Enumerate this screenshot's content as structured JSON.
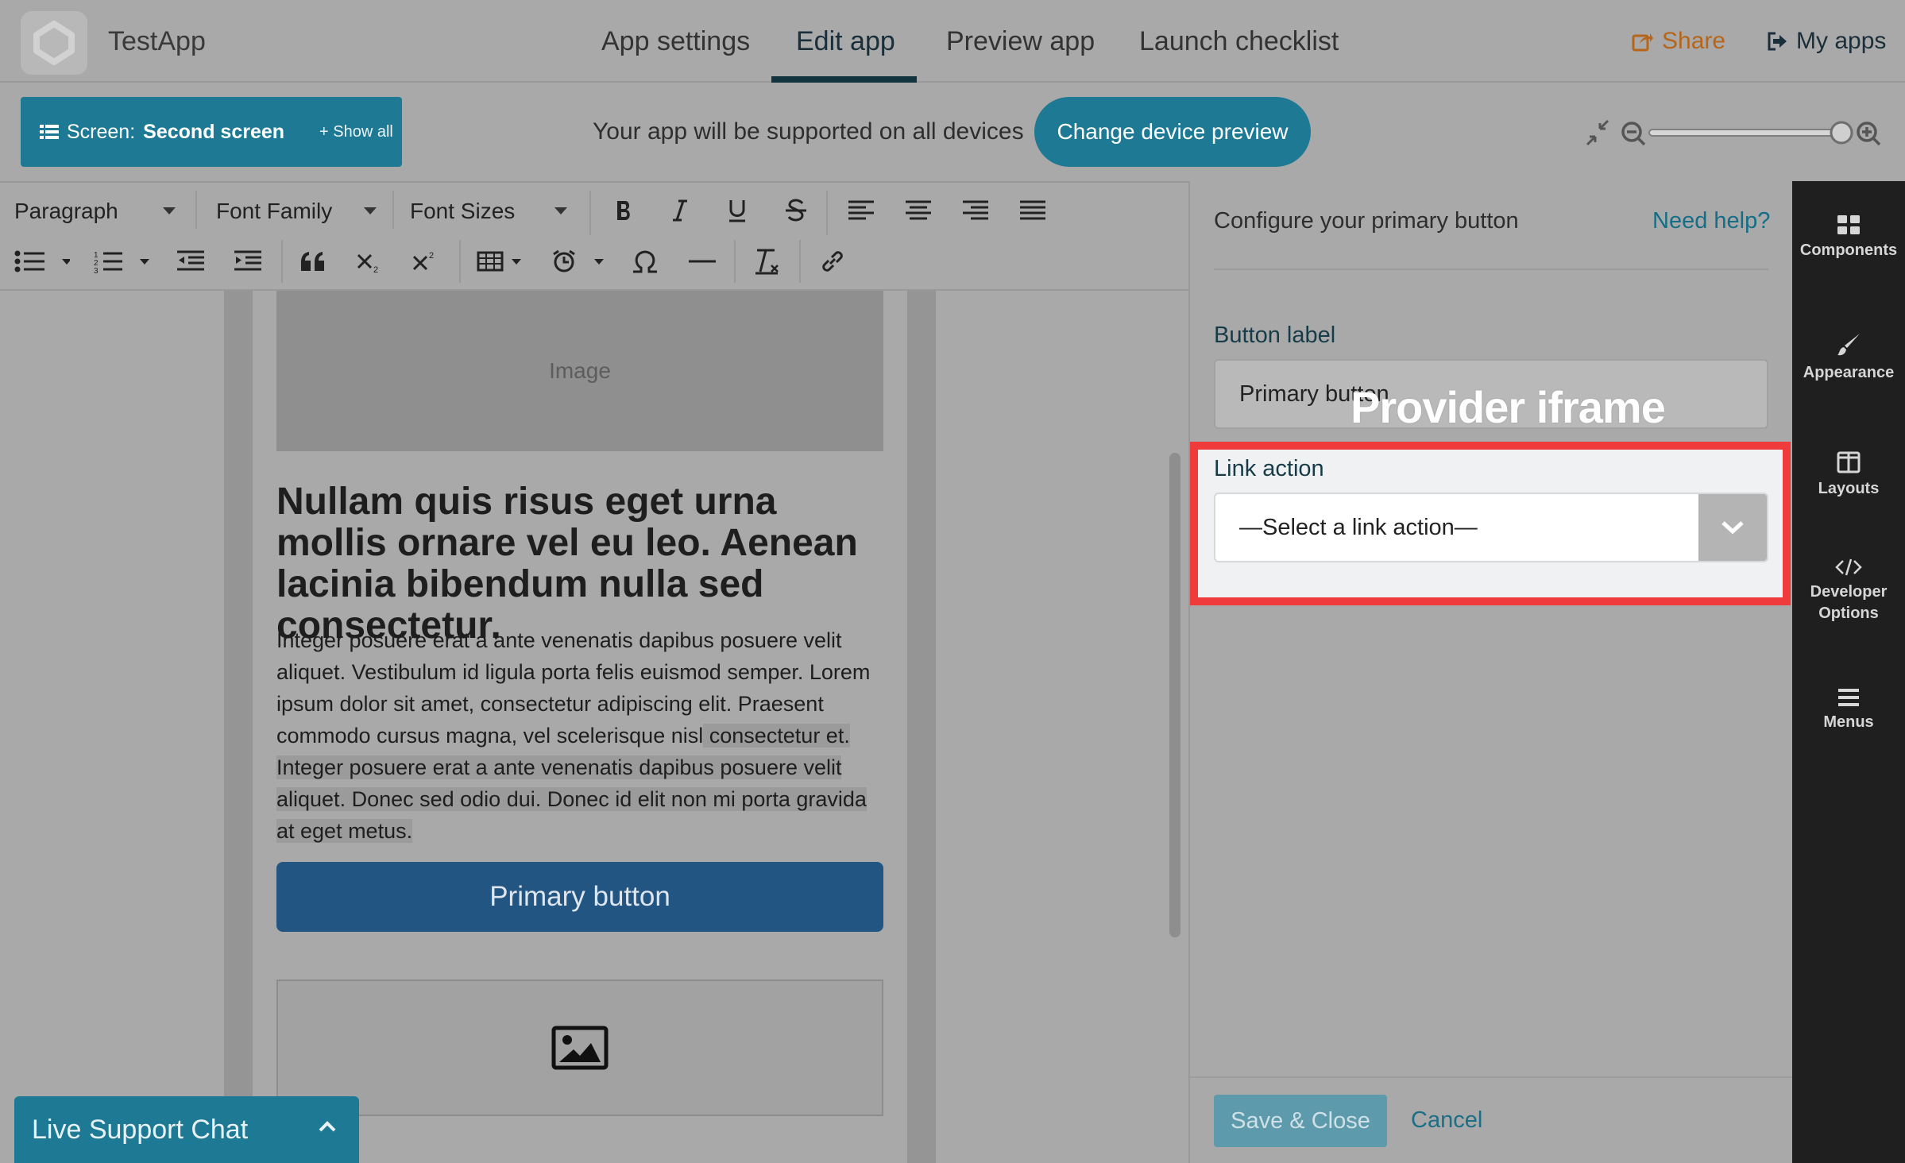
{
  "app": {
    "name": "TestApp"
  },
  "nav": {
    "tabs": [
      {
        "label": "App settings"
      },
      {
        "label": "Edit app"
      },
      {
        "label": "Preview app"
      },
      {
        "label": "Launch checklist"
      }
    ],
    "share_label": "Share",
    "myapps_label": "My apps"
  },
  "screenbar": {
    "screen_prefix": "Screen:",
    "screen_name": "Second screen",
    "show_all": "+ Show all",
    "support_text": "Your app will be supported on all devices",
    "change_device_label": "Change device preview"
  },
  "toolbar": {
    "paragraph": "Paragraph",
    "font_family": "Font Family",
    "font_sizes": "Font Sizes"
  },
  "canvas": {
    "image_label": "Image",
    "heading": "Nullam quis risus eget urna mollis ornare vel eu leo. Aenean lacinia bibendum nulla sed consectetur.",
    "para_plain": "Integer posuere erat a ante venenatis dapibus posuere velit aliquet. Vestibulum id ligula porta felis euismod semper. Lorem ipsum dolor sit amet, consectetur adipiscing elit. Praesent commodo cursus magna, vel scelerisque nisl",
    "para_highlight": " consectetur et. Integer posuere erat a ante venenatis dapibus posuere velit aliquet. Donec sed odio dui. Donec id elit non mi porta gravida at eget metus.",
    "primary_button": "Primary button",
    "live_chat": "Live Support Chat"
  },
  "panel": {
    "title": "Configure your primary button",
    "need_help": "Need help?",
    "button_label_title": "Button label",
    "button_label_value": "Primary button",
    "overlay_label": "Provider iframe",
    "link_action_title": "Link action",
    "link_action_value": "—Select a link action—",
    "save_close": "Save & Close",
    "cancel": "Cancel"
  },
  "sidebar": {
    "items": [
      {
        "label": "Components",
        "icon": "grid-icon"
      },
      {
        "label": "Appearance",
        "icon": "brush-icon"
      },
      {
        "label": "Layouts",
        "icon": "columns-icon"
      },
      {
        "label": "Developer Options",
        "icon": "code-icon"
      },
      {
        "label": "Menus",
        "icon": "hamburger-icon"
      }
    ]
  },
  "colors": {
    "accent": "#1e7a94",
    "primary_button": "#235582",
    "highlight_border": "#ef3b3b",
    "share": "#b5661a",
    "sidebar_bg": "#1f1f1f"
  }
}
